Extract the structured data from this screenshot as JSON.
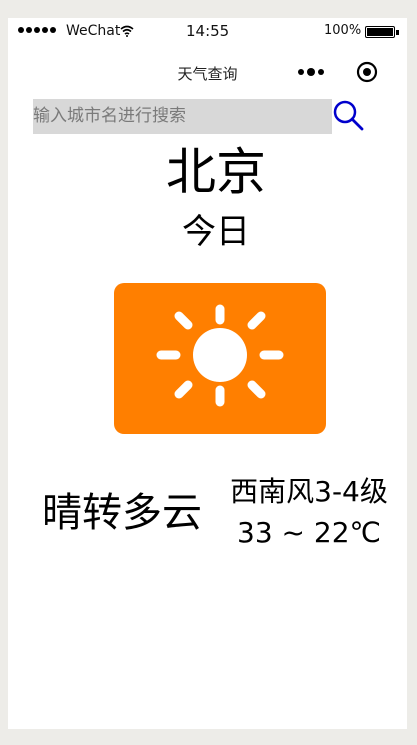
{
  "status_bar": {
    "carrier": "WeChat",
    "time": "14:55",
    "battery": "100%",
    "battery_level": 1.0
  },
  "nav": {
    "title": "天气查询"
  },
  "search": {
    "placeholder": "输入城市名进行搜索",
    "value": ""
  },
  "weather": {
    "city": "北京",
    "day": "今日",
    "icon": "sunny-icon",
    "condition": "晴转多云",
    "wind": "西南风3-4级",
    "temperature": "33 ~ 22℃"
  },
  "colors": {
    "icon_bg": "#ff7f00",
    "search_icon": "#0000cc",
    "search_bg": "#d8d8d8",
    "page_bg": "#edece8"
  }
}
